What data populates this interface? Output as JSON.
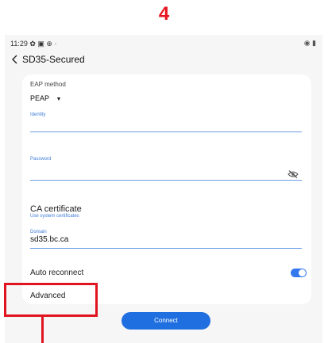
{
  "step_number": "4",
  "status_bar": {
    "time": "11:29",
    "icons": "✿ ▣ ⊕ ·",
    "right_icons": "◉ ▮"
  },
  "header": {
    "back_icon": "chevron-left-icon",
    "title": "SD35-Secured"
  },
  "form": {
    "eap_method_label": "EAP method",
    "eap_method_value": "PEAP",
    "identity_label": "Identity",
    "identity_value": "",
    "password_label": "Password",
    "password_value": "",
    "ca_certificate_label": "CA certificate",
    "ca_certificate_value": "Use system certificates",
    "domain_label": "Domain",
    "domain_value": "sd35.bc.ca",
    "auto_reconnect_label": "Auto reconnect",
    "auto_reconnect_on": true,
    "advanced_label": "Advanced"
  },
  "connect_label": "Connect",
  "colors": {
    "accent": "#1f6fe0",
    "highlight": "#e0141e"
  }
}
